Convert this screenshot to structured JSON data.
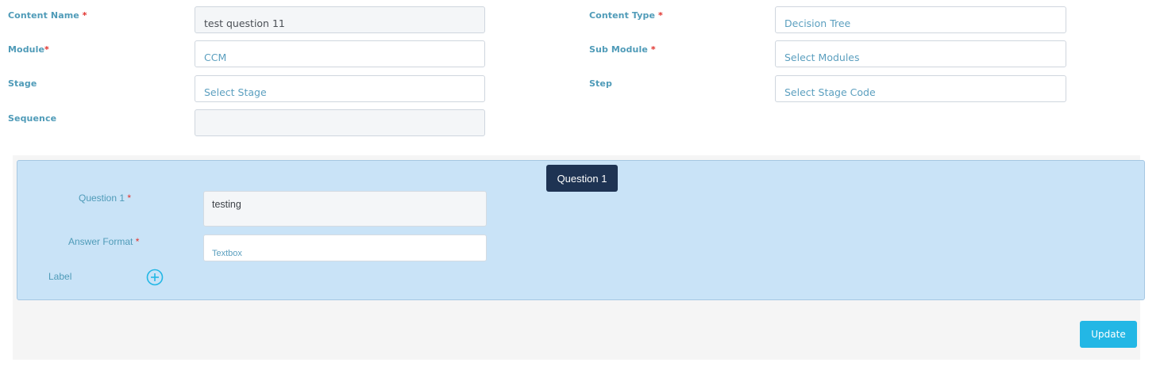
{
  "form": {
    "content_name": {
      "label": "Content Name",
      "required_mark": "*",
      "value": "test question 11"
    },
    "content_type": {
      "label": "Content Type",
      "required_mark": "*",
      "value": "Decision Tree"
    },
    "module": {
      "label": "Module",
      "required_mark": "*",
      "value": "CCM"
    },
    "sub_module": {
      "label": "Sub Module",
      "required_mark": "*",
      "placeholder": "Select Modules"
    },
    "stage": {
      "label": "Stage",
      "placeholder": "Select Stage"
    },
    "step": {
      "label": "Step",
      "placeholder": "Select Stage Code"
    },
    "sequence": {
      "label": "Sequence",
      "value": ""
    }
  },
  "question_panel": {
    "badge": "Question 1",
    "question": {
      "label": "Question 1",
      "required_mark": "*",
      "value": "testing"
    },
    "answer_format": {
      "label": "Answer Format",
      "required_mark": "*",
      "value": "Textbox"
    },
    "label_row": {
      "label": "Label",
      "add_icon": "plus-circle-icon"
    }
  },
  "actions": {
    "update_label": "Update"
  },
  "colors": {
    "label": "#4f9bb8",
    "required": "#e0302b",
    "panel_bg": "#c9e3f7",
    "badge_bg": "#1e3353",
    "button_bg": "#23b7e5"
  }
}
